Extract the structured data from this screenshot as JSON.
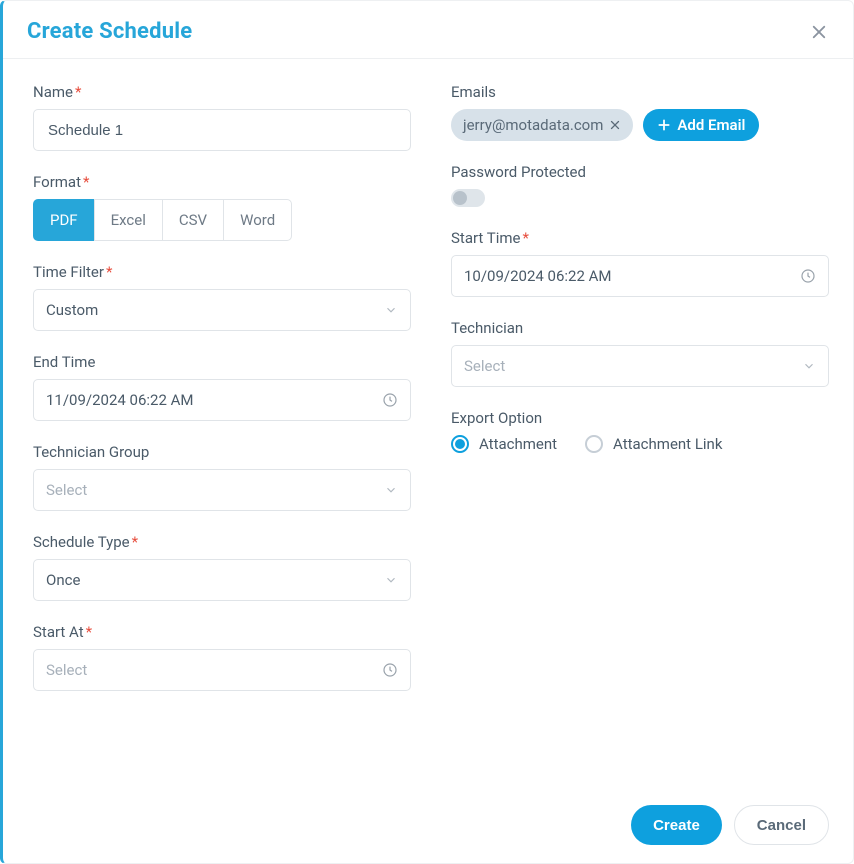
{
  "title": "Create Schedule",
  "labels": {
    "name": "Name",
    "format": "Format",
    "timeFilter": "Time Filter",
    "endTime": "End Time",
    "techGroup": "Technician Group",
    "scheduleType": "Schedule Type",
    "startAt": "Start At",
    "emails": "Emails",
    "passwordProtected": "Password Protected",
    "startTime": "Start Time",
    "technician": "Technician",
    "exportOption": "Export Option"
  },
  "name": {
    "value": "Schedule 1"
  },
  "format": {
    "options": [
      "PDF",
      "Excel",
      "CSV",
      "Word"
    ],
    "selected": "PDF"
  },
  "timeFilter": {
    "value": "Custom"
  },
  "endTime": {
    "value": "11/09/2024 06:22 AM"
  },
  "techGroup": {
    "placeholder": "Select"
  },
  "scheduleType": {
    "value": "Once"
  },
  "startAt": {
    "placeholder": "Select"
  },
  "emails": {
    "items": [
      "jerry@motadata.com"
    ],
    "addLabel": "Add Email"
  },
  "passwordProtected": {
    "on": false
  },
  "startTime": {
    "value": "10/09/2024 06:22 AM"
  },
  "technician": {
    "placeholder": "Select"
  },
  "exportOption": {
    "options": [
      "Attachment",
      "Attachment Link"
    ],
    "selected": "Attachment"
  },
  "footer": {
    "create": "Create",
    "cancel": "Cancel"
  }
}
